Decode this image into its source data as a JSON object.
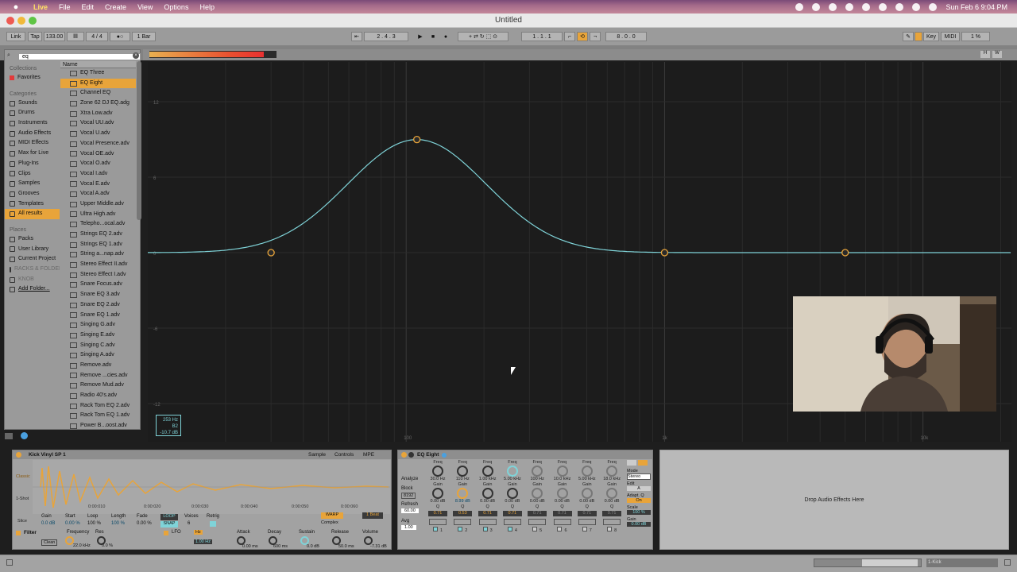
{
  "menubar": {
    "app": "Live",
    "items": [
      "File",
      "Edit",
      "Create",
      "View",
      "Options",
      "Help"
    ],
    "datetime": "Sun Feb 6  9:04 PM"
  },
  "window": {
    "title": "Untitled"
  },
  "control_bar": {
    "link": "Link",
    "tap": "Tap",
    "tempo": "133.00",
    "signature": "4 / 4",
    "quantize": "1 Bar",
    "position": "2 .   4 .   3",
    "loop_start": "1 .   1 .   1",
    "loop_length": "8 .   0 .   0",
    "key": "Key",
    "midi": "MIDI",
    "cpu": "1 %"
  },
  "browser": {
    "search_value": "eq",
    "collections_header": "Collections",
    "favorites": "Favorites",
    "categories_header": "Categories",
    "categories": [
      "Sounds",
      "Drums",
      "Instruments",
      "Audio Effects",
      "MIDI Effects",
      "Max for Live",
      "Plug-Ins",
      "Clips",
      "Samples",
      "Grooves",
      "Templates",
      "All results"
    ],
    "places_header": "Places",
    "places": [
      "Packs",
      "User Library",
      "Current Project",
      "RACKS & FOLDERS",
      "KNOB",
      "Add Folder..."
    ],
    "name_col": "Name",
    "results": [
      "EQ Three",
      "EQ Eight",
      "Channel EQ",
      "Zone 62 DJ EQ.adg",
      "Xtra Low.adv",
      "Vocal UU.adv",
      "Vocal U.adv",
      "Vocal Presence.adv",
      "Vocal OE.adv",
      "Vocal O.adv",
      "Vocal I.adv",
      "Vocal E.adv",
      "Vocal A.adv",
      "Upper Middle.adv",
      "Ultra High.adv",
      "Telepho...ocal.adv",
      "Strings EQ 2.adv",
      "Strings EQ 1.adv",
      "String a...nap.adv",
      "Stereo Effect II.adv",
      "Stereo Effect I.adv",
      "Snare Focus.adv",
      "Snare EQ 3.adv",
      "Snare EQ 2.adv",
      "Snare EQ 1.adv",
      "Singing G.adv",
      "Singing E.adv",
      "Singing C.adv",
      "Singing A.adv",
      "Remove.adv",
      "Remove ...cies.adv",
      "Remove Mud.adv",
      "Radio 40's.adv",
      "Rack Tom EQ 2.adv",
      "Rack Tom EQ 1.adv",
      "Power B...oost.adv"
    ]
  },
  "eq_display": {
    "y_ticks": [
      "12",
      "6",
      "0",
      "-6",
      "-12"
    ],
    "x_ticks": [
      "100",
      "1k",
      "10k"
    ],
    "info_freq": "253 Hz",
    "info_note": "B2",
    "info_gain": "-10.7 dB"
  },
  "simpler": {
    "title": "Kick Vinyl SP 1",
    "tabs": [
      "Sample",
      "Controls",
      "MPE"
    ],
    "modes": [
      "Classic",
      "1-Shot",
      "Slice"
    ],
    "params": [
      "Gain",
      "Start",
      "Loop",
      "Length",
      "Fade"
    ],
    "param_values": [
      "0.0 dB",
      "0.00 %",
      "100 %",
      "100 %",
      "0.00 %"
    ],
    "warp": "WARP",
    "beat": "1 Beat",
    "warp_mode": "Complex",
    "voices_label": "Voices",
    "voices": "6",
    "retrig": "Retrig",
    "loop": "LOOP",
    "snap": "SNAP",
    "filter": "Filter",
    "filter_type": "Clean",
    "freq_label": "Frequency",
    "freq_val": "22.0 kHz",
    "res_label": "Res",
    "res_val": "0.0 %",
    "lfo": "LFO",
    "lfo_hz": "Hz",
    "lfo_rate": "1.00 Hz",
    "env": [
      "Attack",
      "Decay",
      "Sustain",
      "Release",
      "Volume"
    ],
    "env_vals": [
      "0.00 ms",
      "600 ms",
      "0.0 dB",
      "50.0 ms",
      "-7.31 dB"
    ],
    "time_ticks": [
      "0:00:010",
      "0:00:020",
      "0:00:030",
      "0:00:040",
      "0:00:050",
      "0:00:060"
    ]
  },
  "eq8": {
    "title": "EQ Eight",
    "analyze": "Analyze",
    "block": "Block",
    "block_val": "8192",
    "refresh": "Refresh",
    "refresh_val": "60.00",
    "avg": "Avg",
    "avg_val": "1.00",
    "freq_label": "Freq",
    "gain_label": "Gain",
    "q_label": "Q",
    "bands": [
      {
        "freq": "30.0 Hz",
        "gain": "0.00 dB",
        "q": "0.71",
        "num": "1"
      },
      {
        "freq": "110 Hz",
        "gain": "8.99 dB",
        "q": "0.53",
        "num": "2"
      },
      {
        "freq": "1.00 kHz",
        "gain": "0.00 dB",
        "q": "0.71",
        "num": "3"
      },
      {
        "freq": "5.00 kHz",
        "gain": "0.00 dB",
        "q": "0.71",
        "num": "4"
      },
      {
        "freq": "100 Hz",
        "gain": "0.00 dB",
        "q": "0.71",
        "num": "5"
      },
      {
        "freq": "10.0 kHz",
        "gain": "0.00 dB",
        "q": "0.71",
        "num": "6"
      },
      {
        "freq": "5.00 kHz",
        "gain": "0.00 dB",
        "q": "0.71",
        "num": "7"
      },
      {
        "freq": "18.0 kHz",
        "gain": "0.00 dB",
        "q": "0.71",
        "num": "8"
      }
    ],
    "mode": "Mode",
    "mode_val": "Stereo",
    "edit": "Edit",
    "edit_val": "A",
    "adapt_q": "Adapt. Q",
    "adapt_val": "On",
    "scale": "Scale",
    "scale_val": "100 %",
    "gain": "Gain",
    "gain_val": "0.00 dB"
  },
  "drop_zone": "Drop Audio Effects Here",
  "status": {
    "track": "1-Kick"
  },
  "colors": {
    "accent": "#e8a43a",
    "curve": "#7fd3d8",
    "panel": "#a2a2a2"
  }
}
